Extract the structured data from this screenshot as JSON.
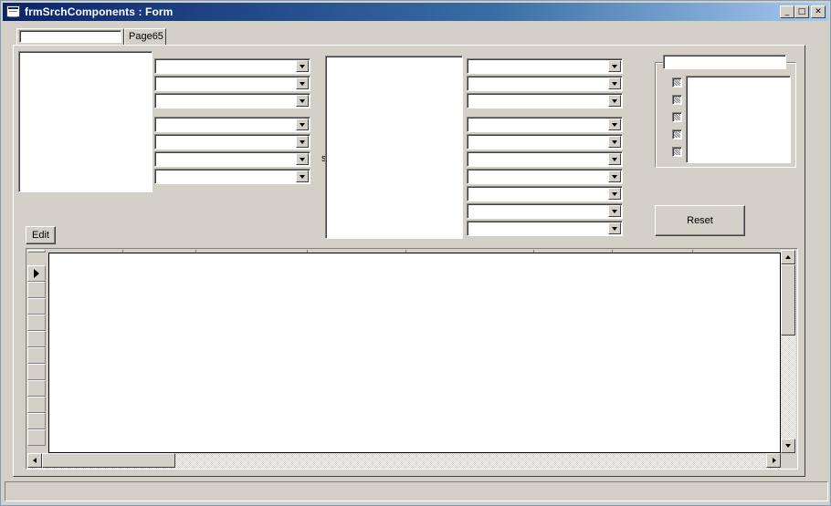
{
  "window": {
    "title": "frmSrchComponents : Form",
    "min_glyph": "_",
    "max_glyph": "□",
    "close_glyph": "✕"
  },
  "tabs": {
    "search_value": "",
    "page_label": "Page65"
  },
  "form": {
    "stray_label": "s",
    "group_header_value": "",
    "edit_label": "Edit",
    "reset_label": "Reset"
  },
  "icons": {
    "app": "form-icon",
    "combo_arrow": "chevron-down-icon",
    "record_selector": "triangle-right-icon"
  }
}
